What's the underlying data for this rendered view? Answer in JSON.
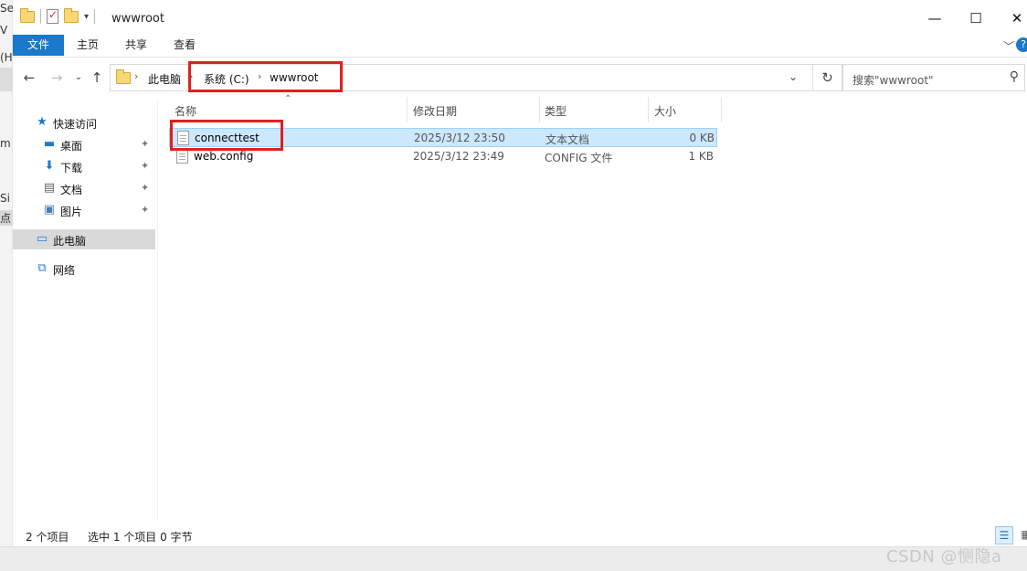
{
  "background_window": {
    "title_fragment": "Services (IIS)管理器",
    "fragments": [
      "V",
      "(H",
      "m",
      "Si",
      "点"
    ]
  },
  "titlebar": {
    "title": "wwwroot",
    "minimize": "—",
    "maximize": "☐",
    "close": "✕"
  },
  "ribbon": {
    "tabs": [
      "文件",
      "主页",
      "共享",
      "查看"
    ],
    "expand_icon": "chevron-down-icon",
    "help_icon": "?"
  },
  "address_bar": {
    "path": [
      "此电脑",
      "系统 (C:)",
      "wwwroot"
    ]
  },
  "search": {
    "placeholder": "搜索\"wwwroot\""
  },
  "nav_pane": {
    "quick_access": {
      "label": "快速访问",
      "items": [
        {
          "label": "桌面",
          "icon": "desktop-icon",
          "pinned": true
        },
        {
          "label": "下载",
          "icon": "download-icon",
          "pinned": true
        },
        {
          "label": "文档",
          "icon": "document-icon",
          "pinned": true
        },
        {
          "label": "图片",
          "icon": "pictures-icon",
          "pinned": true
        }
      ]
    },
    "this_pc": "此电脑",
    "network": "网络",
    "selected": "此电脑"
  },
  "file_list": {
    "columns": [
      "名称",
      "修改日期",
      "类型",
      "大小"
    ],
    "rows": [
      {
        "name": "connecttest",
        "modified": "2025/3/12 23:50",
        "type": "文本文档",
        "size": "0 KB",
        "selected": true
      },
      {
        "name": "web.config",
        "modified": "2025/3/12 23:49",
        "type": "CONFIG 文件",
        "size": "1 KB",
        "selected": false
      }
    ]
  },
  "status_bar": {
    "item_count": "2 个项目",
    "selection": "选中 1 个项目  0 字节"
  },
  "highlight_color": "#e02020",
  "accent_color": "#1979ca",
  "watermark": "CSDN @恻隐a"
}
